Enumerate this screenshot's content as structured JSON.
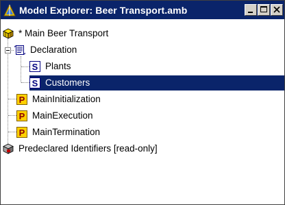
{
  "window": {
    "title": "Model Explorer: Beer Transport.amb",
    "titlebar_color": "#0a246a",
    "buttons": [
      "minimize",
      "maximize",
      "close"
    ]
  },
  "tree": {
    "root_label": "* Main Beer Transport",
    "declaration_label": "Declaration",
    "plants_label": "Plants",
    "customers_label": "Customers",
    "main_init_label": "MainInitialization",
    "main_exec_label": "MainExecution",
    "main_term_label": "MainTermination",
    "predeclared_label": "Predeclared Identifiers [read-only]",
    "selected": "Customers",
    "selection_color": "#0a246a",
    "set_icon_letter": "S",
    "procedure_icon_letter": "P"
  }
}
